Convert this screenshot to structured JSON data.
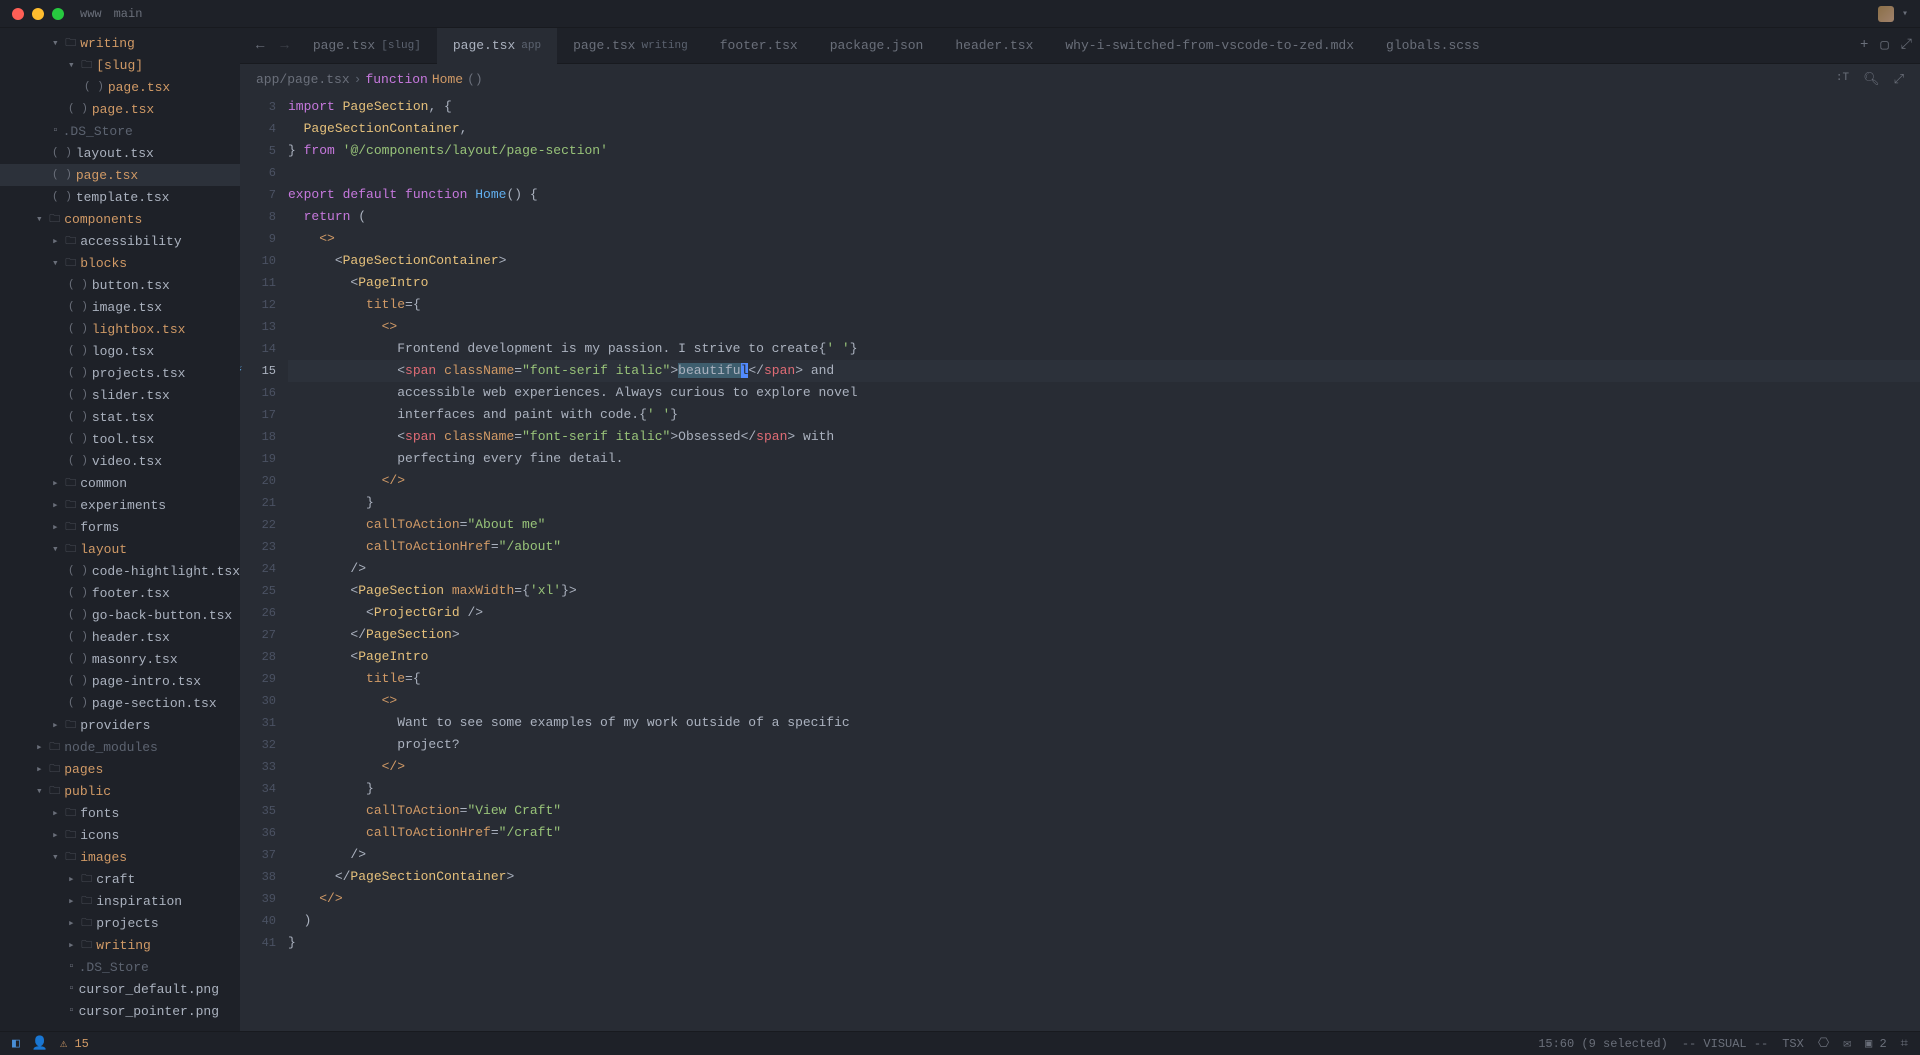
{
  "titlebar": {
    "project": "www",
    "branch": "main"
  },
  "sidebar": {
    "items": [
      {
        "label": "writing",
        "type": "folder-open",
        "indent": 2,
        "highlight": true
      },
      {
        "label": "[slug]",
        "type": "folder-open",
        "indent": 3,
        "highlight": true
      },
      {
        "label": "page.tsx",
        "type": "file-tsx",
        "indent": 4,
        "highlight": true
      },
      {
        "label": "page.tsx",
        "type": "file-tsx",
        "indent": 3,
        "highlight": true
      },
      {
        "label": ".DS_Store",
        "type": "file",
        "indent": 2,
        "dim": true
      },
      {
        "label": "layout.tsx",
        "type": "file-tsx",
        "indent": 2
      },
      {
        "label": "page.tsx",
        "type": "file-tsx",
        "indent": 2,
        "highlight": true,
        "active": true
      },
      {
        "label": "template.tsx",
        "type": "file-tsx",
        "indent": 2
      },
      {
        "label": "components",
        "type": "folder-open",
        "indent": 1,
        "highlight": true
      },
      {
        "label": "accessibility",
        "type": "folder",
        "indent": 2
      },
      {
        "label": "blocks",
        "type": "folder-open",
        "indent": 2,
        "highlight": true
      },
      {
        "label": "button.tsx",
        "type": "file-tsx",
        "indent": 3
      },
      {
        "label": "image.tsx",
        "type": "file-tsx",
        "indent": 3
      },
      {
        "label": "lightbox.tsx",
        "type": "file-tsx",
        "indent": 3,
        "highlight": true
      },
      {
        "label": "logo.tsx",
        "type": "file-tsx",
        "indent": 3
      },
      {
        "label": "projects.tsx",
        "type": "file-tsx",
        "indent": 3
      },
      {
        "label": "slider.tsx",
        "type": "file-tsx",
        "indent": 3
      },
      {
        "label": "stat.tsx",
        "type": "file-tsx",
        "indent": 3
      },
      {
        "label": "tool.tsx",
        "type": "file-tsx",
        "indent": 3
      },
      {
        "label": "video.tsx",
        "type": "file-tsx",
        "indent": 3
      },
      {
        "label": "common",
        "type": "folder",
        "indent": 2
      },
      {
        "label": "experiments",
        "type": "folder",
        "indent": 2
      },
      {
        "label": "forms",
        "type": "folder",
        "indent": 2
      },
      {
        "label": "layout",
        "type": "folder-open",
        "indent": 2,
        "highlight": true
      },
      {
        "label": "code-hightlight.tsx",
        "type": "file-tsx",
        "indent": 3
      },
      {
        "label": "footer.tsx",
        "type": "file-tsx",
        "indent": 3
      },
      {
        "label": "go-back-button.tsx",
        "type": "file-tsx",
        "indent": 3
      },
      {
        "label": "header.tsx",
        "type": "file-tsx",
        "indent": 3
      },
      {
        "label": "masonry.tsx",
        "type": "file-tsx",
        "indent": 3
      },
      {
        "label": "page-intro.tsx",
        "type": "file-tsx",
        "indent": 3
      },
      {
        "label": "page-section.tsx",
        "type": "file-tsx",
        "indent": 3
      },
      {
        "label": "providers",
        "type": "folder",
        "indent": 2
      },
      {
        "label": "node_modules",
        "type": "folder",
        "indent": 1,
        "dim": true
      },
      {
        "label": "pages",
        "type": "folder",
        "indent": 1,
        "highlight": true
      },
      {
        "label": "public",
        "type": "folder-open",
        "indent": 1,
        "highlight": true
      },
      {
        "label": "fonts",
        "type": "folder",
        "indent": 2
      },
      {
        "label": "icons",
        "type": "folder",
        "indent": 2
      },
      {
        "label": "images",
        "type": "folder-open",
        "indent": 2,
        "highlight": true
      },
      {
        "label": "craft",
        "type": "folder",
        "indent": 3
      },
      {
        "label": "inspiration",
        "type": "folder",
        "indent": 3
      },
      {
        "label": "projects",
        "type": "folder",
        "indent": 3
      },
      {
        "label": "writing",
        "type": "folder",
        "indent": 3,
        "highlight": true
      },
      {
        "label": ".DS_Store",
        "type": "file",
        "indent": 3,
        "dim": true
      },
      {
        "label": "cursor_default.png",
        "type": "file",
        "indent": 3
      },
      {
        "label": "cursor_pointer.png",
        "type": "file",
        "indent": 3
      }
    ]
  },
  "tabs": [
    {
      "label": "page.tsx",
      "suffix": "[slug]"
    },
    {
      "label": "page.tsx",
      "suffix": "app",
      "active": true
    },
    {
      "label": "page.tsx",
      "suffix": "writing"
    },
    {
      "label": "footer.tsx"
    },
    {
      "label": "package.json"
    },
    {
      "label": "header.tsx"
    },
    {
      "label": "why-i-switched-from-vscode-to-zed.mdx"
    },
    {
      "label": "globals.scss"
    }
  ],
  "breadcrumb": {
    "path": "app/page.tsx",
    "fn_kw": "function",
    "fn_name": "Home",
    "fn_parens": "()"
  },
  "code": {
    "lines": [
      3,
      4,
      5,
      6,
      7,
      8,
      9,
      10,
      11,
      12,
      13,
      14,
      15,
      16,
      17,
      18,
      19,
      20,
      21,
      22,
      23,
      24,
      25,
      26,
      27,
      28,
      29,
      30,
      31,
      32,
      33,
      34,
      35,
      36,
      37,
      38,
      39,
      40,
      41
    ],
    "active_line": 15
  },
  "statusbar": {
    "warnings": "15",
    "position": "15:60 (9 selected)",
    "mode": "-- VISUAL --",
    "lang": "TSX",
    "diag_count": "2"
  }
}
